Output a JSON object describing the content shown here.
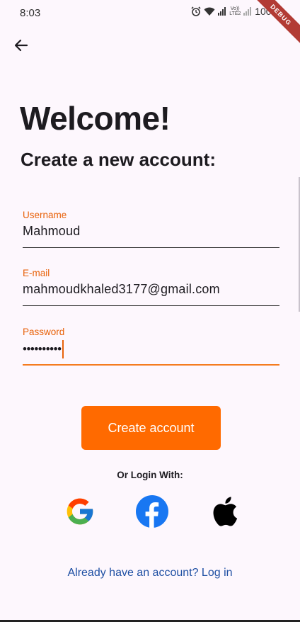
{
  "status_bar": {
    "time": "8:03",
    "battery": "100%",
    "network_label": "Vo)) LTE2",
    "debug_banner": "DEBUG"
  },
  "header": {
    "back_icon": "arrow-left-icon"
  },
  "content": {
    "welcome": "Welcome!",
    "subtitle": "Create a new account:"
  },
  "form": {
    "username": {
      "label": "Username",
      "value": "Mahmoud"
    },
    "email": {
      "label": "E-mail",
      "value": "mahmoudkhaled3177@gmail.com"
    },
    "password": {
      "label": "Password",
      "value": "••••••••••"
    }
  },
  "actions": {
    "create_account": "Create account",
    "or_login_with": "Or Login With:",
    "social": [
      "google-icon",
      "facebook-icon",
      "apple-icon"
    ],
    "login_link": "Already have an account? Log in"
  },
  "colors": {
    "accent": "#ff6a00",
    "label": "#e8620a",
    "link": "#1e4fa3",
    "background": "#fdf7fd",
    "facebook": "#1877f2"
  }
}
